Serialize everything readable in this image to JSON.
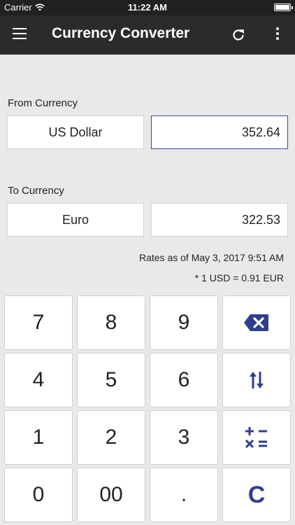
{
  "status_bar": {
    "carrier": "Carrier",
    "time": "11:22 AM"
  },
  "app_bar": {
    "title": "Currency Converter"
  },
  "from": {
    "label": "From Currency",
    "currency": "US Dollar",
    "amount": "352.64"
  },
  "to": {
    "label": "To Currency",
    "currency": "Euro",
    "amount": "322.53"
  },
  "rates": {
    "as_of": "Rates as of May 3, 2017 9:51 AM",
    "rate": "* 1 USD = 0.91 EUR"
  },
  "keypad": {
    "keys": {
      "k7": "7",
      "k8": "8",
      "k9": "9",
      "k4": "4",
      "k5": "5",
      "k6": "6",
      "k1": "1",
      "k2": "2",
      "k3": "3",
      "k0": "0",
      "k00": "00",
      "dot": ".",
      "clear": "C"
    },
    "icons": {
      "backspace": "backspace-icon",
      "swap": "swap-icon",
      "operations": "operations-icon"
    }
  },
  "colors": {
    "accent": "#2f3e8f",
    "app_bar": "#2b2b2b",
    "background": "#e9e9e9"
  }
}
